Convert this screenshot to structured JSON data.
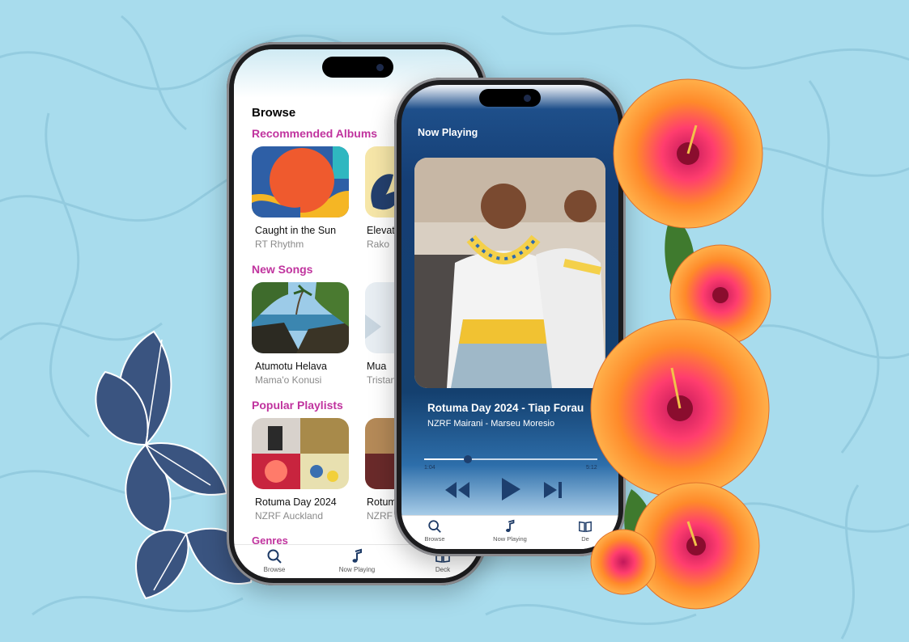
{
  "browse": {
    "title": "Browse",
    "sections": {
      "recommended": "Recommended Albums",
      "new_songs": "New Songs",
      "playlists": "Popular Playlists",
      "genres": "Genres"
    },
    "albums": [
      {
        "name": "Caught in the Sun",
        "artist": "RT Rhythm"
      },
      {
        "name": "Elevat",
        "artist": "Rako"
      }
    ],
    "songs": [
      {
        "name": "Atumotu Helava",
        "artist": "Mama'o Konusi"
      },
      {
        "name": "Mua",
        "artist": "Tristan"
      }
    ],
    "playlists": [
      {
        "name": "Rotuma Day 2024",
        "artist": "NZRF Auckland"
      },
      {
        "name": "Rotum",
        "artist": "NZRF"
      }
    ],
    "tabs": {
      "browse": "Browse",
      "now_playing": "Now Playing",
      "deck": "Deck"
    }
  },
  "now_playing": {
    "title": "Now Playing",
    "song": "Rotuma Day 2024 - Tiap Forau",
    "artist": "NZRF Mairani - Marseu Moresio",
    "elapsed": "1:04",
    "duration": "5:12",
    "progress_fraction": 0.25,
    "tabs": {
      "browse": "Browse",
      "now_playing": "Now Playing",
      "deck": "De"
    }
  },
  "colors": {
    "background": "#a8dced",
    "section_heading": "#c0339e",
    "player_blue": "#153e74",
    "flower_navy": "#3a5480",
    "hibiscus_orange": "#ff8a2a"
  },
  "icons": [
    "search-icon",
    "music-note-icon",
    "book-icon",
    "rewind-icon",
    "play-icon",
    "skip-forward-icon"
  ]
}
